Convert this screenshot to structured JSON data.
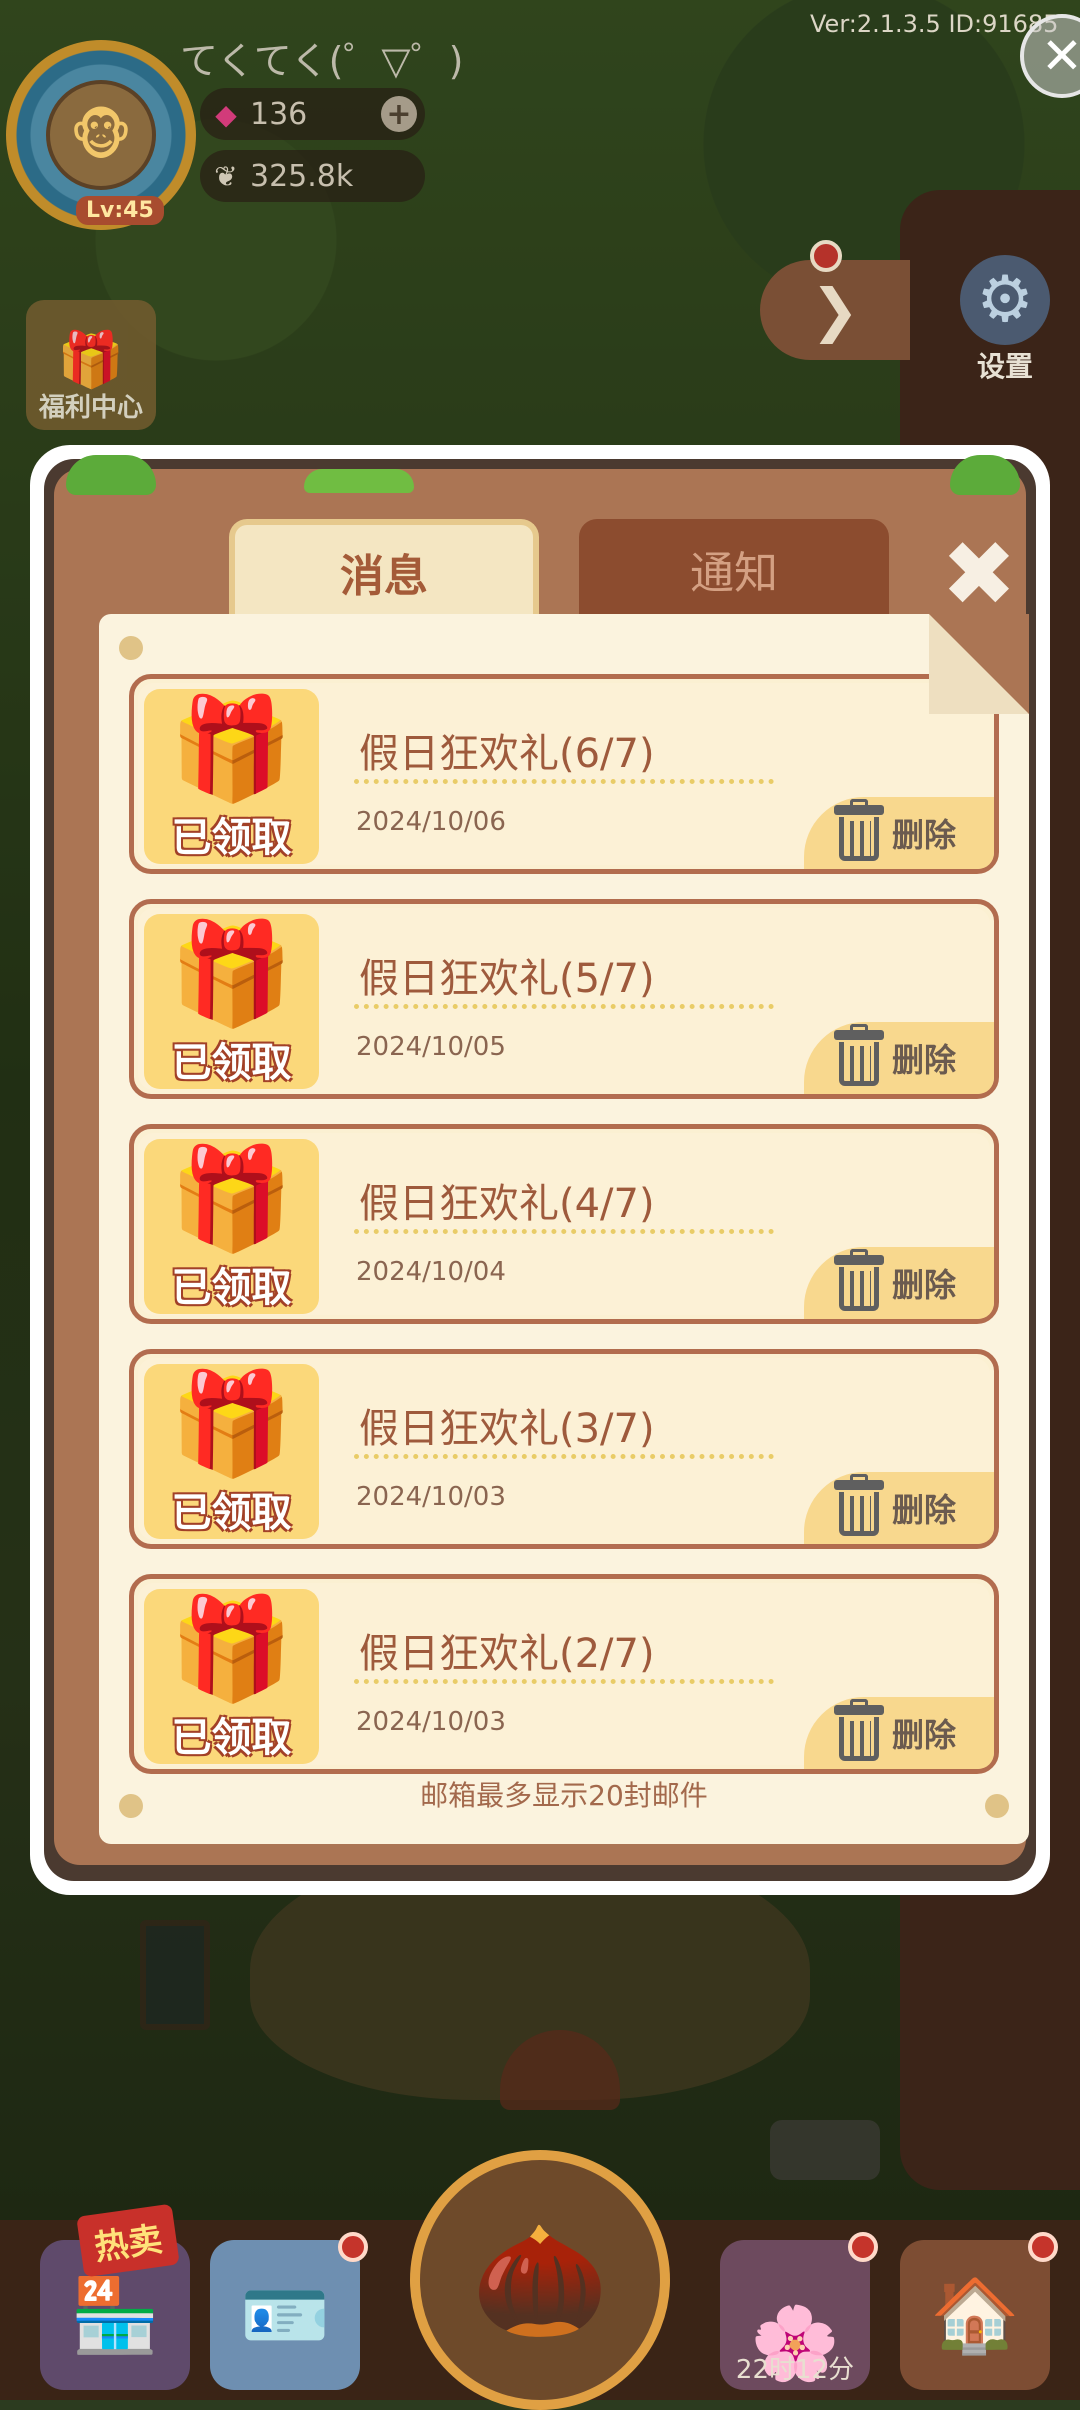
{
  "hud": {
    "username": "てくてく(゜▽゜)",
    "level": "Lv:45",
    "gems": "136",
    "seeds": "325.8k",
    "version": "Ver:2.1.3.5 ID:91685",
    "welfare_label": "福利中心"
  },
  "side": {
    "settings_label": "设置"
  },
  "dialog": {
    "tab_messages": "消息",
    "tab_notice": "通知",
    "footer": "邮箱最多显示20封邮件",
    "claimed_label": "已领取",
    "delete_label": "删除",
    "mails": [
      {
        "title": "假日狂欢礼(6/7)",
        "date": "2024/10/06"
      },
      {
        "title": "假日狂欢礼(5/7)",
        "date": "2024/10/05"
      },
      {
        "title": "假日狂欢礼(4/7)",
        "date": "2024/10/04"
      },
      {
        "title": "假日狂欢礼(3/7)",
        "date": "2024/10/03"
      },
      {
        "title": "假日狂欢礼(2/7)",
        "date": "2024/10/03"
      }
    ]
  },
  "bottom": {
    "shop_badge": "热卖",
    "timer": "22时12分"
  }
}
